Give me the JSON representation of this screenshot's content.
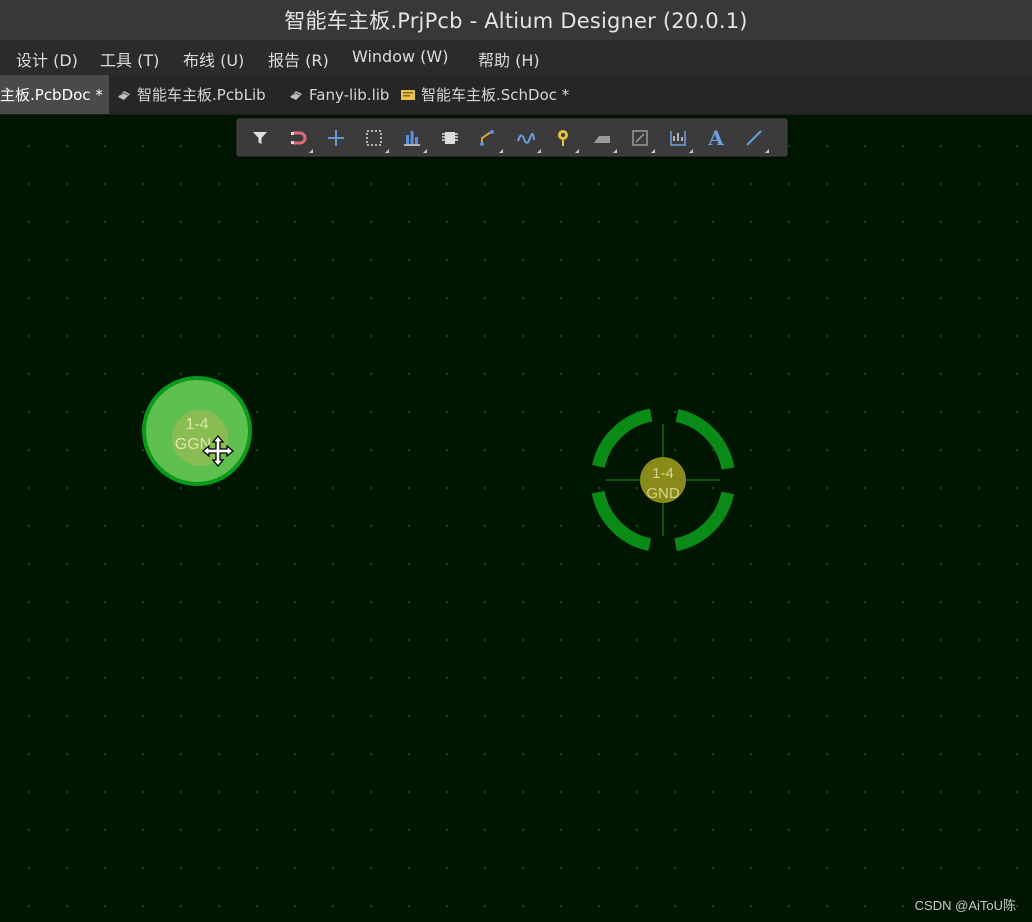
{
  "window": {
    "title": "智能车主板.PrjPcb - Altium Designer (20.0.1)"
  },
  "menu": [
    {
      "label": "设计 (D)"
    },
    {
      "label": "工具 (T)"
    },
    {
      "label": "布线 (U)"
    },
    {
      "label": "报告 (R)"
    },
    {
      "label": "Window (W)"
    },
    {
      "label": "帮助 (H)"
    }
  ],
  "tabs": [
    {
      "label": "主板.PcbDoc *",
      "active": true
    },
    {
      "label": "智能车主板.PcbLib",
      "icon": "pcblib-icon"
    },
    {
      "label": "Fany-lib.lib",
      "icon": "lib-icon"
    },
    {
      "label": "智能车主板.SchDoc *",
      "icon": "schdoc-icon"
    }
  ],
  "toolbar": {
    "buttons": [
      {
        "name": "filter-icon"
      },
      {
        "name": "snap-magnet-icon"
      },
      {
        "name": "crosshair-icon"
      },
      {
        "name": "select-rect-icon"
      },
      {
        "name": "align-icon"
      },
      {
        "name": "component-icon"
      },
      {
        "name": "route-track-icon"
      },
      {
        "name": "interactive-route-icon"
      },
      {
        "name": "place-via-icon"
      },
      {
        "name": "fill-icon"
      },
      {
        "name": "polygon-icon"
      },
      {
        "name": "dimension-icon"
      },
      {
        "name": "text-icon",
        "label": "A"
      },
      {
        "name": "line-icon"
      }
    ]
  },
  "pcb": {
    "pad_moving": {
      "designator": "1-4",
      "net": "GGN"
    },
    "pad_placed": {
      "designator": "1-4",
      "net": "GND"
    },
    "colors": {
      "background": "#001600",
      "grid": "#1b4a1b",
      "pad_moving": "#5fbf4f",
      "pad_ring": "#0a8a17",
      "pad_center": "#8a8a1a",
      "pad_text": "#d6d68a"
    }
  },
  "watermark": "CSDN @AiToU陈"
}
